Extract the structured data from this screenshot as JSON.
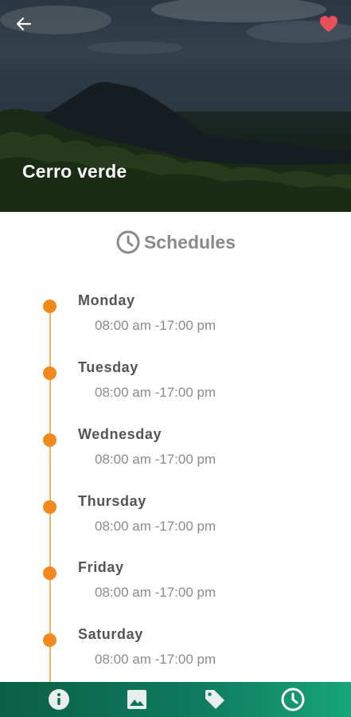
{
  "hero": {
    "title": "Cerro verde",
    "back_icon": "arrow-left-icon",
    "favorite_icon": "heart-icon",
    "favorite_color": "#e8505b"
  },
  "section": {
    "title": "Schedules",
    "icon": "clock-icon",
    "color": "#8a8a8a"
  },
  "schedule": [
    {
      "day": "Monday",
      "hours": "08:00 am -17:00 pm"
    },
    {
      "day": "Tuesday",
      "hours": "08:00 am -17:00 pm"
    },
    {
      "day": "Wednesday",
      "hours": "08:00 am -17:00 pm"
    },
    {
      "day": "Thursday",
      "hours": "08:00 am -17:00 pm"
    },
    {
      "day": "Friday",
      "hours": "08:00 am -17:00 pm"
    },
    {
      "day": "Saturday",
      "hours": "08:00 am -17:00 pm"
    }
  ],
  "timeline_color": "#f08a1e",
  "bottom_nav": {
    "items": [
      {
        "icon": "info-icon",
        "active": false
      },
      {
        "icon": "image-icon",
        "active": false
      },
      {
        "icon": "tag-icon",
        "active": false
      },
      {
        "icon": "clock-icon",
        "active": true
      }
    ],
    "gradient_start": "#0b5f47",
    "gradient_end": "#17a579"
  }
}
